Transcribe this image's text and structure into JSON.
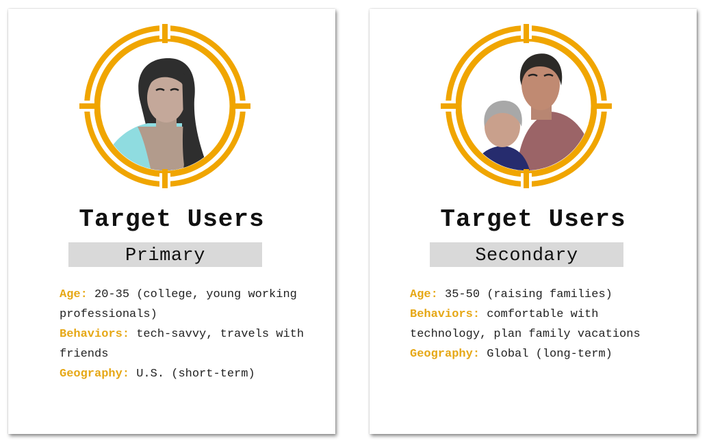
{
  "colors": {
    "accent": "#f0a500",
    "badge_bg": "#d9d9d9",
    "label": "#e6a817"
  },
  "cards": [
    {
      "title": "Target Users",
      "badge": "Primary",
      "fields": [
        {
          "label": "Age:",
          "value": "20-35 (college, young working professionals)"
        },
        {
          "label": "Behaviors:",
          "value": "tech-savvy, travels with friends"
        },
        {
          "label": "Geography:",
          "value": "U.S. (short-term)"
        }
      ]
    },
    {
      "title": "Target Users",
      "badge": "Secondary",
      "fields": [
        {
          "label": "Age:",
          "value": "35-50 (raising families)"
        },
        {
          "label": "Behaviors:",
          "value": "comfortable with technology, plan family vacations"
        },
        {
          "label": "Geography:",
          "value": "Global (long-term)"
        }
      ]
    }
  ]
}
